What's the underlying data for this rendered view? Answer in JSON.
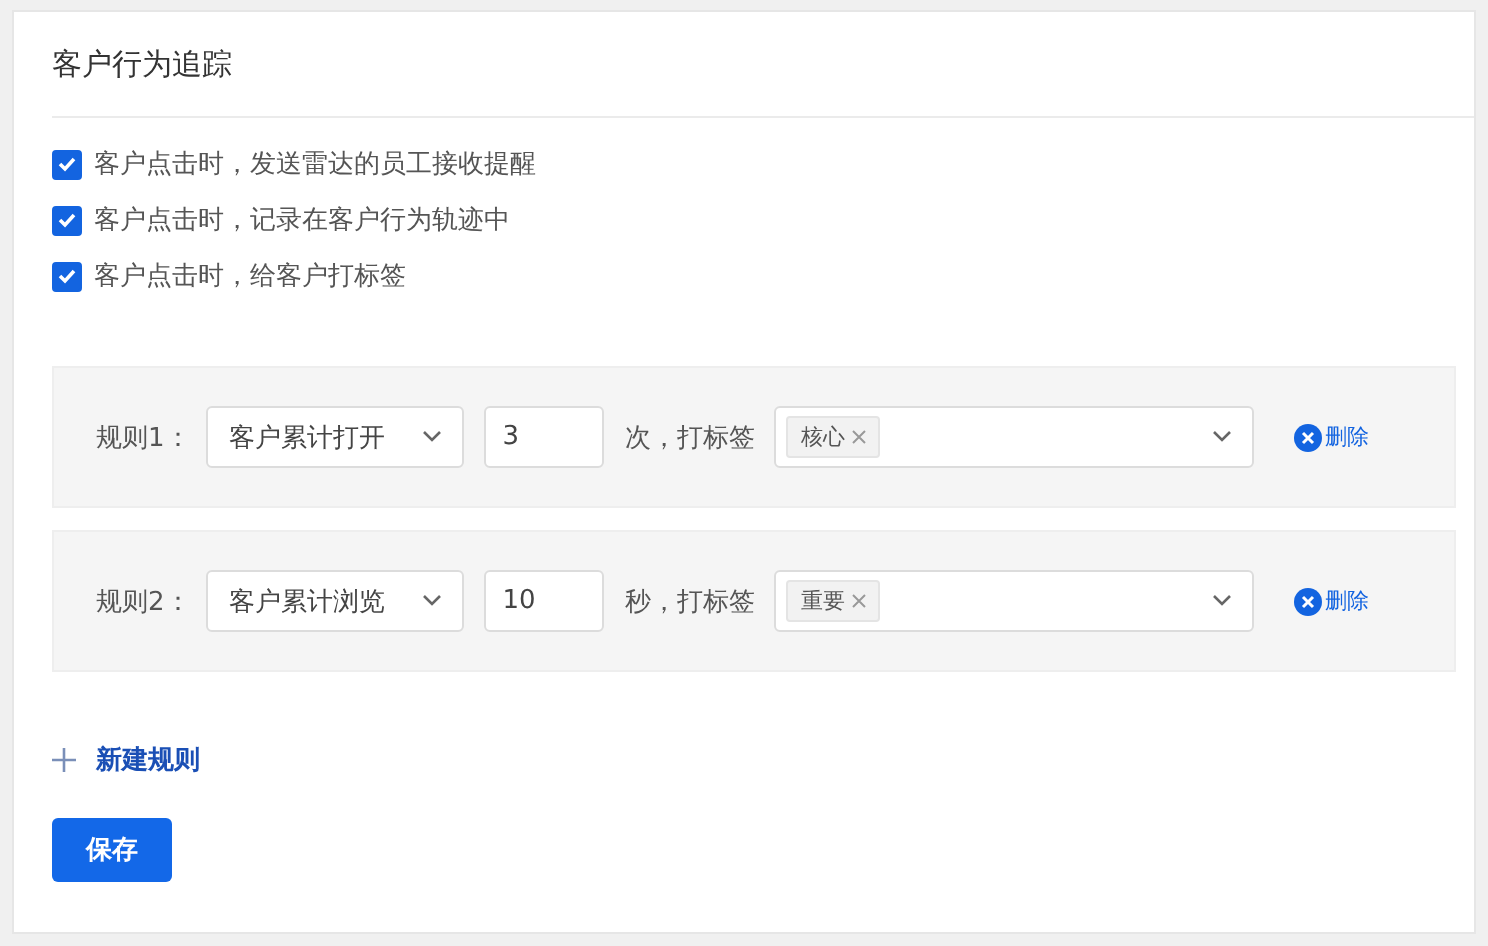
{
  "title": "客户行为追踪",
  "options": [
    {
      "label": "客户点击时，发送雷达的员工接收提醒",
      "checked": true
    },
    {
      "label": "客户点击时，记录在客户行为轨迹中",
      "checked": true
    },
    {
      "label": "客户点击时，给客户打标签",
      "checked": true
    }
  ],
  "rules": [
    {
      "label": "规则1：",
      "condition": "客户累计打开",
      "value": "3",
      "unit_text": "次，打标签",
      "tags": [
        "核心"
      ],
      "delete": "删除"
    },
    {
      "label": "规则2：",
      "condition": "客户累计浏览",
      "value": "10",
      "unit_text": "秒，打标签",
      "tags": [
        "重要"
      ],
      "delete": "删除"
    }
  ],
  "add_rule": "新建规则",
  "save": "保存"
}
